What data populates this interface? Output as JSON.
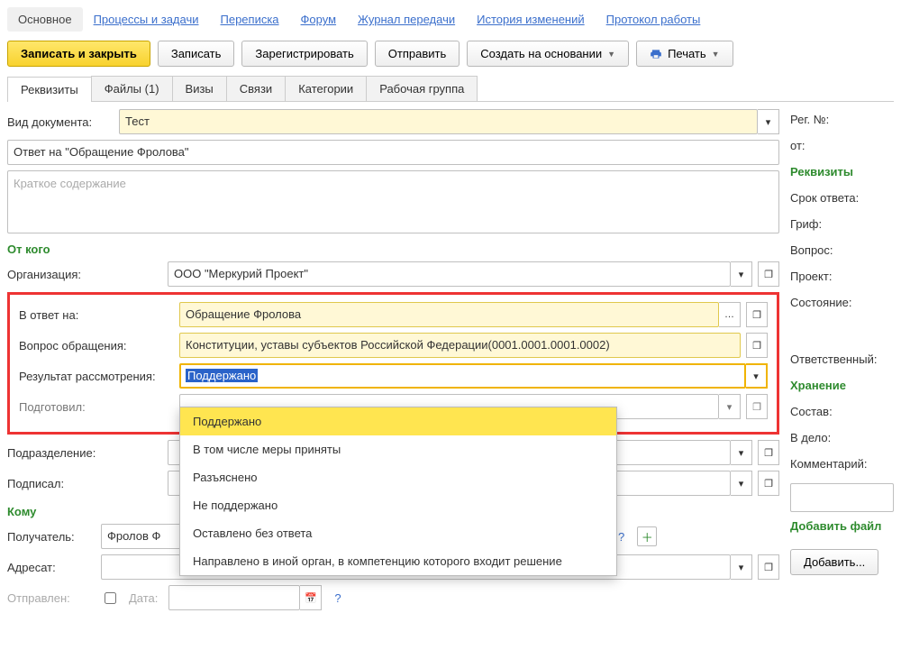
{
  "nav": {
    "items": [
      {
        "label": "Основное",
        "active": true
      },
      {
        "label": "Процессы и задачи"
      },
      {
        "label": "Переписка"
      },
      {
        "label": "Форум"
      },
      {
        "label": "Журнал передачи"
      },
      {
        "label": "История изменений"
      },
      {
        "label": "Протокол работы"
      }
    ]
  },
  "toolbar": {
    "save_close": "Записать и закрыть",
    "save": "Записать",
    "register": "Зарегистрировать",
    "send": "Отправить",
    "create_based": "Создать на основании",
    "print": "Печать"
  },
  "subtabs": [
    {
      "label": "Реквизиты",
      "active": true
    },
    {
      "label": "Файлы (1)"
    },
    {
      "label": "Визы"
    },
    {
      "label": "Связи"
    },
    {
      "label": "Категории"
    },
    {
      "label": "Рабочая группа"
    }
  ],
  "form": {
    "doc_type_label": "Вид документа:",
    "doc_type_value": "Тест",
    "title_value": "Ответ на \"Обращение Фролова\"",
    "summary_placeholder": "Краткое содержание",
    "from_head": "От кого",
    "org_label": "Организация:",
    "org_value": "ООО \"Меркурий Проект\"",
    "reply_to_label": "В ответ на:",
    "reply_to_value": "Обращение Фролова",
    "question_label": "Вопрос обращения:",
    "question_value": "Конституции, уставы субъектов Российской Федерации(0001.0001.0001.0002)",
    "result_label": "Результат рассмотрения:",
    "result_value": "Поддержано",
    "prepared_label": "Подготовил:",
    "dept_label": "Подразделение:",
    "signed_label": "Подписал:",
    "to_head": "Кому",
    "recipient_label": "Получатель:",
    "recipient_value": "Фролов Ф",
    "addressee_label": "Адресат:",
    "sent_label": "Отправлен:",
    "date_label": "Дата:"
  },
  "dropdown": {
    "options": [
      "Поддержано",
      "В том числе меры приняты",
      "Разъяснено",
      "Не поддержано",
      "Оставлено без ответа",
      "Направлено в иной орган, в компетенцию которого входит решение"
    ]
  },
  "side": {
    "reg_no": "Рег. №:",
    "from": "от:",
    "rekv_head": "Реквизиты",
    "reply_term": "Срок ответа:",
    "grif": "Гриф:",
    "question": "Вопрос:",
    "project": "Проект:",
    "state": "Состояние:",
    "responsible": "Ответственный:",
    "storage_head": "Хранение",
    "sostav": "Состав:",
    "vdelo": "В дело:",
    "comment": "Комментарий:",
    "add_file": "Добавить файл",
    "add_btn": "Добавить..."
  }
}
